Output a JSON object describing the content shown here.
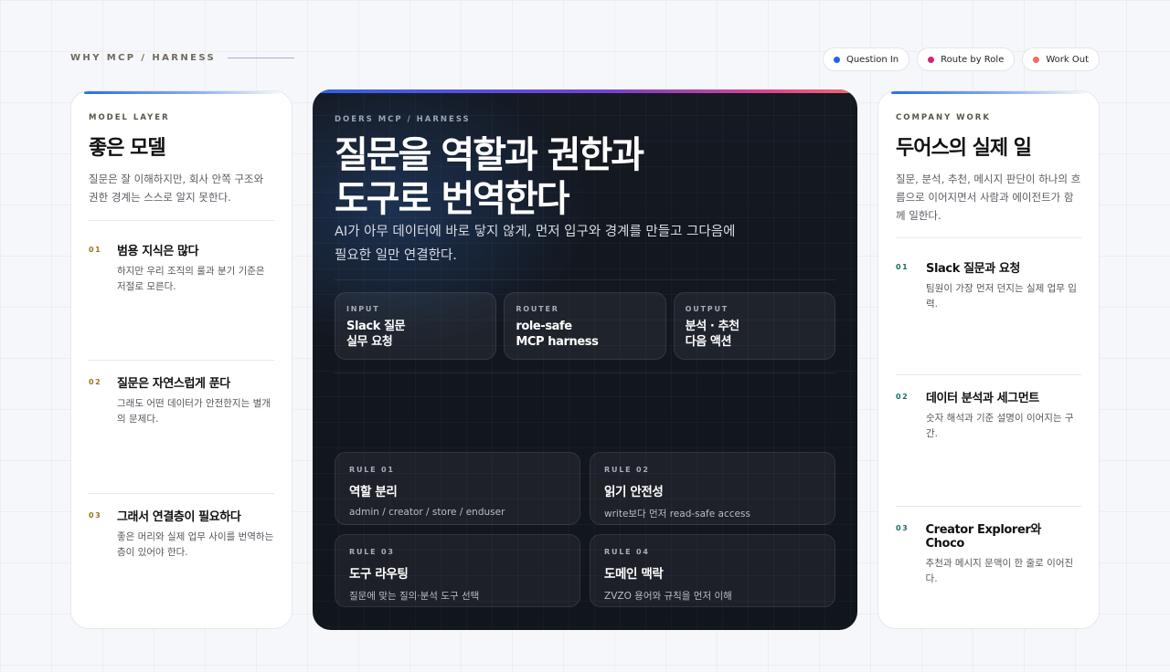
{
  "header": {
    "eyebrow": "WHY MCP / HARNESS",
    "chips": [
      {
        "label": "Question In",
        "color": "#2563eb"
      },
      {
        "label": "Route by Role",
        "color": "#d3246f"
      },
      {
        "label": "Work Out",
        "color": "#f26b5b"
      }
    ]
  },
  "left": {
    "kicker": "MODEL LAYER",
    "title": "좋은 모델",
    "desc": "질문은 잘 이해하지만, 회사 안쪽 구조와 권한 경계는 스스로 알지 못한다.",
    "num_color": "#9a7420",
    "items": [
      {
        "num": "01",
        "title": "범용 지식은 많다",
        "desc": "하지만 우리 조직의 룰과 분기 기준은 저절로 모른다."
      },
      {
        "num": "02",
        "title": "질문은 자연스럽게 푼다",
        "desc": "그래도 어떤 데이터가 안전한지는 별개의 문제다."
      },
      {
        "num": "03",
        "title": "그래서 연결층이 필요하다",
        "desc": "좋은 머리와 실제 업무 사이를 번역하는 층이 있어야 한다."
      }
    ]
  },
  "center": {
    "kicker": "DOERS MCP / HARNESS",
    "title_line1": "질문을 역할과 권한과",
    "title_line2": "도구로 번역한다",
    "sub_line1": "AI가 아무 데이터에 바로 닿지 않게, 먼저 입구와 경계를 만들고 그다음에",
    "sub_line2": "필요한 일만 연결한다.",
    "flow": [
      {
        "label": "INPUT",
        "line1": "Slack 질문",
        "line2": "실무 요청"
      },
      {
        "label": "ROUTER",
        "line1": "role-safe",
        "line2": "MCP harness"
      },
      {
        "label": "OUTPUT",
        "line1": "분석 · 추천",
        "line2": "다음 액션"
      }
    ],
    "rules": [
      {
        "label": "RULE 01",
        "title": "역할 분리",
        "desc": "admin / creator / store / enduser"
      },
      {
        "label": "RULE 02",
        "title": "읽기 안전성",
        "desc": "write보다 먼저 read-safe access"
      },
      {
        "label": "RULE 03",
        "title": "도구 라우팅",
        "desc": "질문에 맞는 질의·분석 도구 선택"
      },
      {
        "label": "RULE 04",
        "title": "도메인 맥락",
        "desc": "ZVZO 용어와 규칙을 먼저 이해"
      }
    ]
  },
  "right": {
    "kicker": "COMPANY WORK",
    "title": "두어스의 실제 일",
    "desc": "질문, 분석, 추천, 메시지 판단이 하나의 흐름으로 이어지면서 사람과 에이전트가 함께 일한다.",
    "num_color": "#1a6b62",
    "items": [
      {
        "num": "01",
        "title": "Slack 질문과 요청",
        "desc": "팀원이 가장 먼저 던지는 실제 업무 입력."
      },
      {
        "num": "02",
        "title": "데이터 분석과 세그먼트",
        "desc": "숫자 해석과 기준 설명이 이어지는 구간."
      },
      {
        "num": "03",
        "title": "Creator Explorer와 Choco",
        "desc": "추천과 메시지 문맥이 한 줄로 이어진다."
      }
    ]
  }
}
